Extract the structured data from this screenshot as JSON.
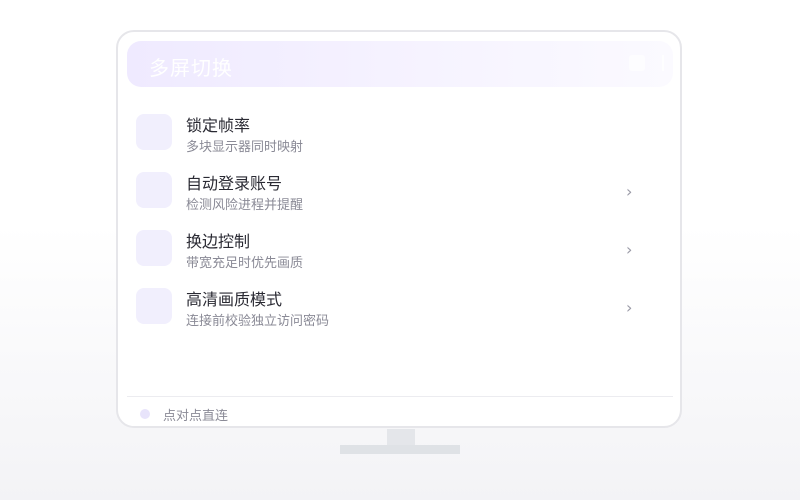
{
  "header": {
    "title": "多屏切换"
  },
  "menu": {
    "items": [
      {
        "title": "锁定帧率",
        "subtitle": "多块显示器同时映射",
        "chevron": ""
      },
      {
        "title": "自动登录账号",
        "subtitle": "检测风险进程并提醒",
        "chevron": "›"
      },
      {
        "title": "换边控制",
        "subtitle": "带宽充足时优先画质",
        "chevron": "›"
      },
      {
        "title": "高清画质模式",
        "subtitle": "连接前校验独立访问密码",
        "chevron": "›"
      }
    ]
  },
  "footer": {
    "status_text": "点对点直连"
  },
  "colors": {
    "accent_light": "#efeaff",
    "icon_tile": "#f1effd",
    "title_text": "#2a2a33",
    "subtitle_text": "#8a8a96"
  }
}
